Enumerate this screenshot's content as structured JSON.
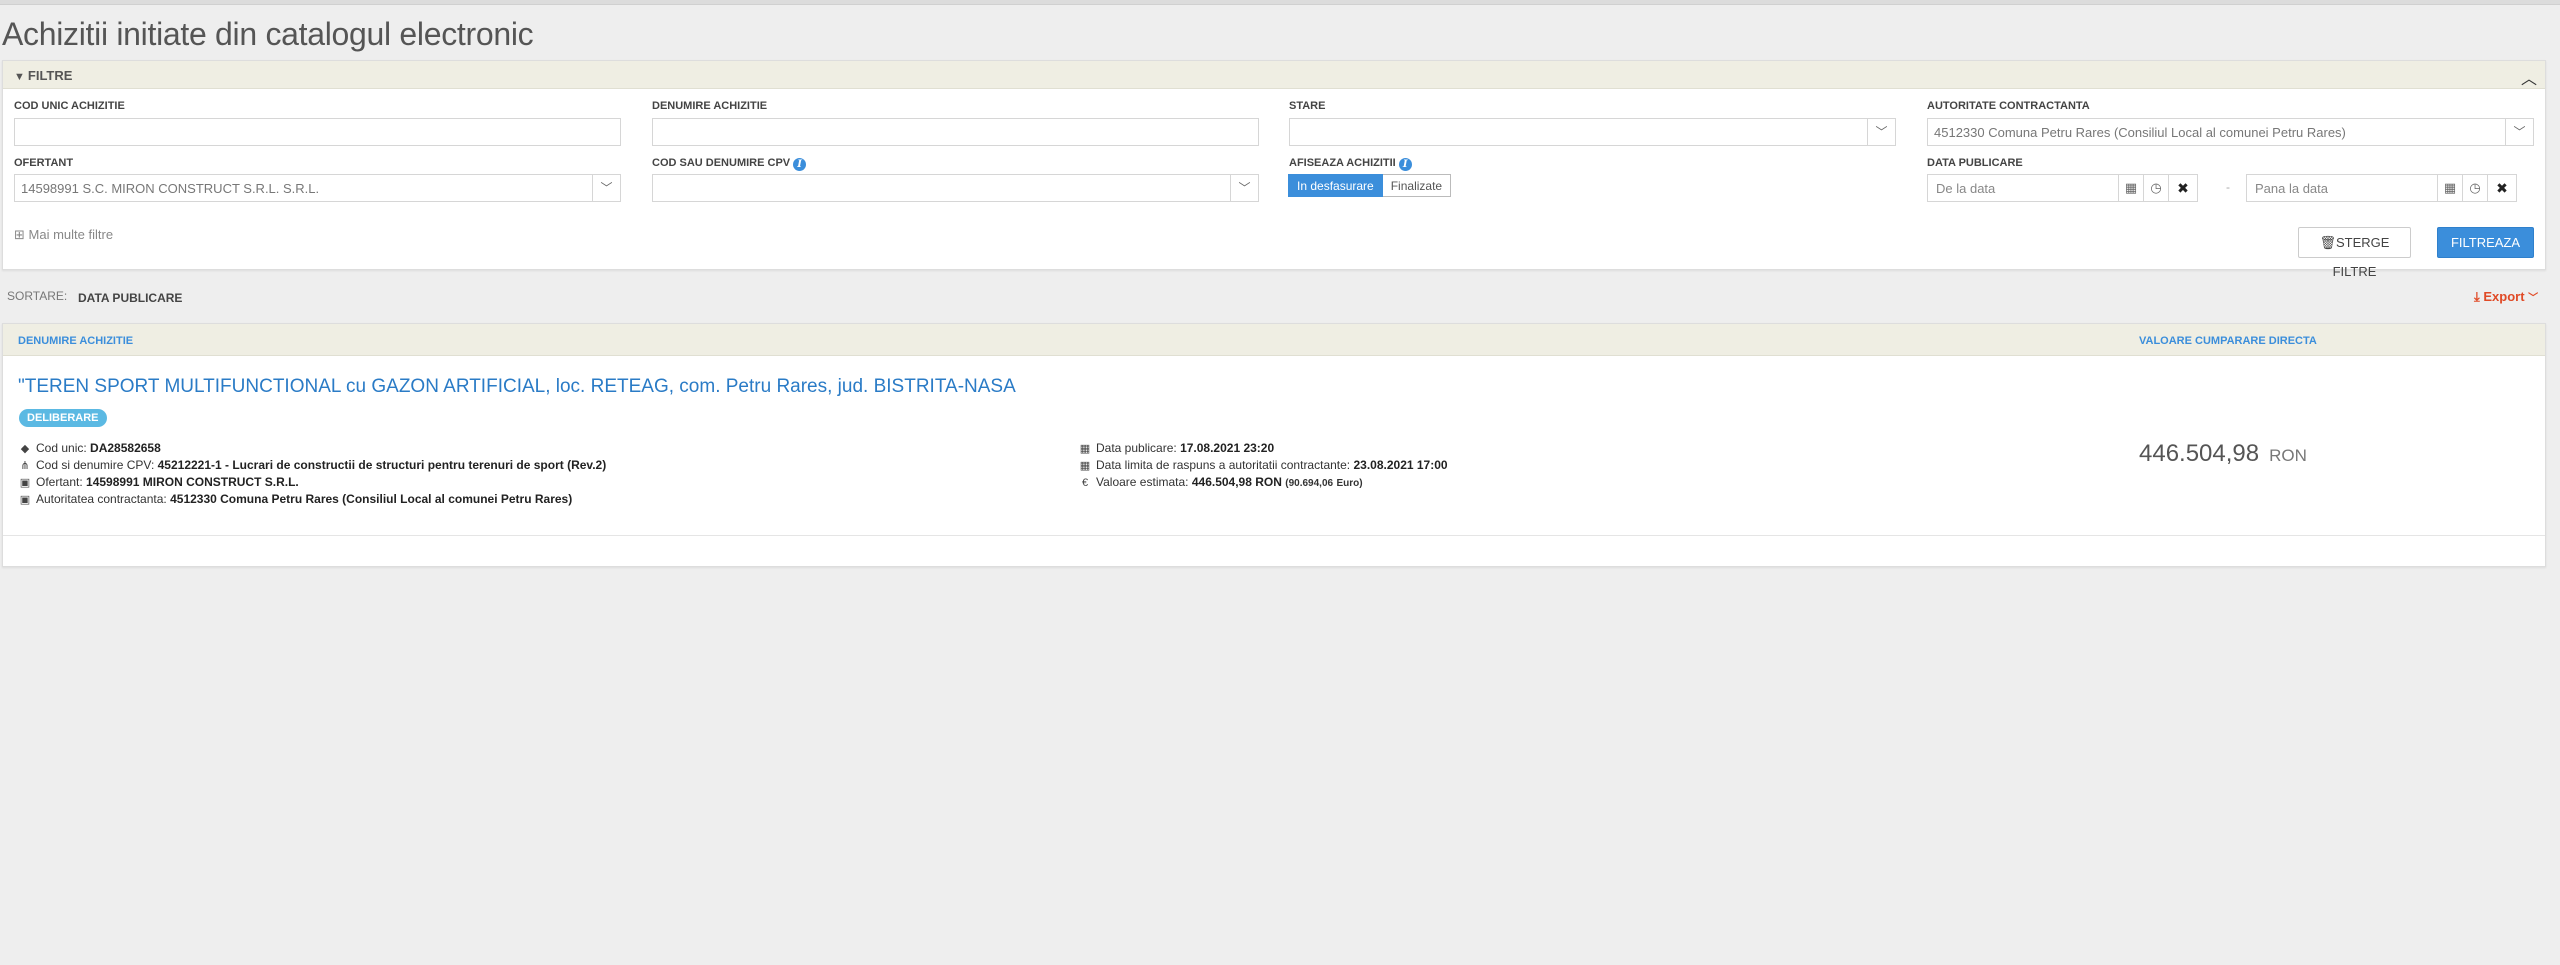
{
  "page_title": "Achizitii initiate din catalogul electronic",
  "filters": {
    "header": "FILTRE",
    "cod_unic": {
      "label": "COD UNIC ACHIZITIE",
      "value": ""
    },
    "denumire": {
      "label": "DENUMIRE ACHIZITIE",
      "value": ""
    },
    "stare": {
      "label": "STARE",
      "value": ""
    },
    "autoritate": {
      "label": "AUTORITATE CONTRACTANTA",
      "value": "4512330 Comuna Petru Rares (Consiliul Local al comunei Petru Rares)"
    },
    "ofertant": {
      "label": "OFERTANT",
      "value": "14598991 S.C. MIRON CONSTRUCT S.R.L. S.R.L."
    },
    "cpv": {
      "label": "COD SAU DENUMIRE CPV",
      "value": ""
    },
    "afiseaza": {
      "label": "AFISEAZA ACHIZITII",
      "options": [
        "In desfasurare",
        "Finalizate"
      ],
      "selected": "In desfasurare"
    },
    "data_publicare": {
      "label": "DATA PUBLICARE",
      "from_placeholder": "De la data",
      "to_placeholder": "Pana la data",
      "dash": "-"
    },
    "more": "Mai multe filtre",
    "clear_button": "STERGE FILTRE",
    "filter_button": "FILTREAZA"
  },
  "sort": {
    "label": "SORTARE:",
    "value": "DATA PUBLICARE"
  },
  "export_label": "Export",
  "table": {
    "col_name": "DENUMIRE ACHIZITIE",
    "col_value": "VALOARE CUMPARARE DIRECTA",
    "rows": [
      {
        "title": "\"TEREN SPORT MULTIFUNCTIONAL cu GAZON ARTIFICIAL, loc. RETEAG, com. Petru Rares, jud. BISTRITA-NASA",
        "status": "DELIBERARE",
        "cod_unic_label": "Cod unic:",
        "cod_unic": "DA28582658",
        "cpv_label": "Cod si denumire CPV:",
        "cpv": "45212221-1 - Lucrari de constructii de structuri pentru terenuri de sport (Rev.2)",
        "ofertant_label": "Ofertant:",
        "ofertant": "14598991 MIRON CONSTRUCT S.R.L.",
        "autoritate_label": "Autoritatea contractanta:",
        "autoritate": "4512330 Comuna Petru Rares (Consiliul Local al comunei Petru Rares)",
        "data_publicare_label": "Data publicare:",
        "data_publicare": "17.08.2021 23:20",
        "data_limita_label": "Data limita de raspuns a autoritatii contractante:",
        "data_limita": "23.08.2021 17:00",
        "valoare_label": "Valoare estimata:",
        "valoare": "446.504,98",
        "valoare_cur": "RON",
        "valoare_euro": "(90.694,06",
        "valoare_euro_cur": "Euro)",
        "value": "446.504,98",
        "currency": "RON"
      }
    ]
  }
}
